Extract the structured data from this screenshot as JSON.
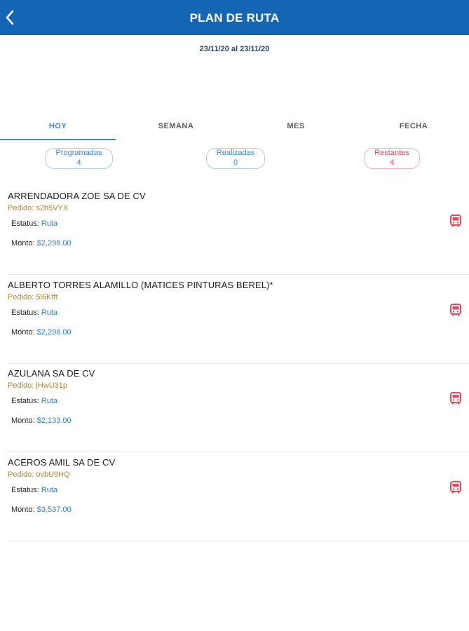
{
  "header": {
    "title": "PLAN DE RUTA",
    "back_icon": "chevron-left-icon"
  },
  "date_range": "23/11/20 al 23/11/20",
  "tabs": [
    {
      "label": "HOY",
      "active": true
    },
    {
      "label": "SEMANA",
      "active": false
    },
    {
      "label": "MES",
      "active": false
    },
    {
      "label": "FECHA",
      "active": false
    }
  ],
  "summary": {
    "programadas": {
      "label": "Programadas",
      "count": "4"
    },
    "realizadas": {
      "label": "Realizadas",
      "count": "0"
    },
    "restantes": {
      "label": "Restantes",
      "count": "4"
    }
  },
  "labels": {
    "status": "Estatus:",
    "amount": "Monto:"
  },
  "orders": [
    {
      "name": "ARRENDADORA ZOE SA DE CV",
      "pedido": "Pedido: s2h5VYX",
      "status": "Ruta",
      "amount": "$2,298.00",
      "icon": "bus-icon"
    },
    {
      "name": "ALBERTO TORRES ALAMILLO (MATICES PINTURAS BEREL)*",
      "pedido": "Pedido: 5l6Ktft",
      "status": "Ruta",
      "amount": "$2,298.00",
      "icon": "bus-icon"
    },
    {
      "name": "AZULANA SA DE CV",
      "pedido": "Pedido: jHwU31p",
      "status": "Ruta",
      "amount": "$2,133.00",
      "icon": "bus-icon"
    },
    {
      "name": "ACEROS AMIL SA DE CV",
      "pedido": "Pedido: ovbU9HQ",
      "status": "Ruta",
      "amount": "$3,537.00",
      "icon": "bus-icon"
    }
  ],
  "colors": {
    "header": "#1565b5",
    "accent": "#3a86d6",
    "pedido": "#a8893a",
    "alert": "#e24a5c"
  }
}
